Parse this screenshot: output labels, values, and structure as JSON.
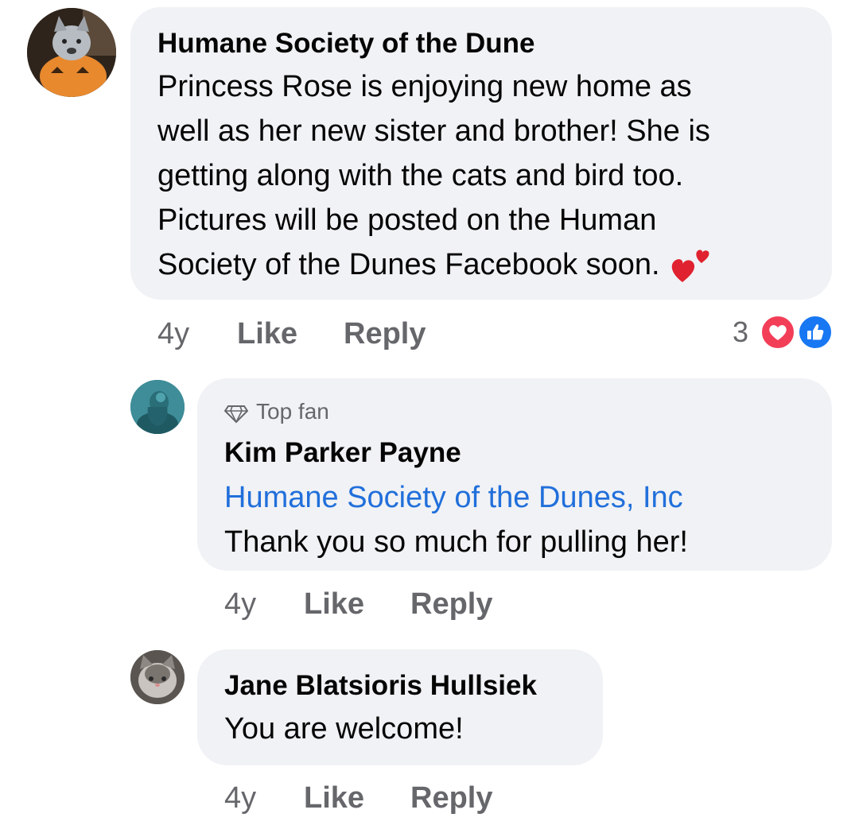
{
  "comments": [
    {
      "author": "Humane Society of the Dune",
      "lines": [
        "Princess Rose is enjoying new home as",
        "well as her new sister and brother! She is",
        "getting along with the cats and bird too.",
        "Pictures will be posted on the Human",
        "Society of the Dunes Facebook soon."
      ],
      "emoji": "two-hearts-icon",
      "time": "4y",
      "like_label": "Like",
      "reply_label": "Reply",
      "reaction_count": "3",
      "reactions": [
        "love-reaction-icon",
        "like-reaction-icon"
      ]
    },
    {
      "badge": "Top fan",
      "author": "Kim Parker Payne",
      "mention": "Humane Society of the Dunes, Inc",
      "text": "Thank you so much for pulling her!",
      "time": "4y",
      "like_label": "Like",
      "reply_label": "Reply"
    },
    {
      "author": "Jane Blatsioris Hullsiek",
      "text": "You are welcome!",
      "time": "4y",
      "like_label": "Like",
      "reply_label": "Reply"
    }
  ],
  "colors": {
    "bubble": "#f0f2f5",
    "meta": "#65676b",
    "mention": "#216fdb",
    "love": "#f33e58",
    "like": "#1877f2"
  }
}
